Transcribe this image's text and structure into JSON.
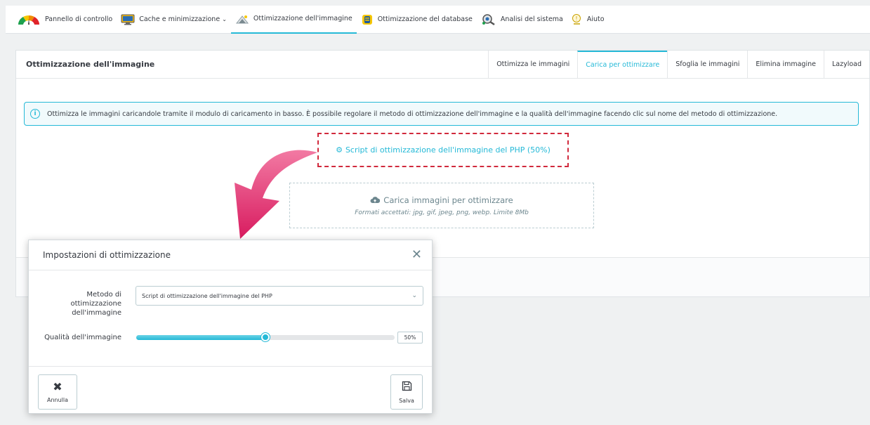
{
  "nav": {
    "items": [
      {
        "label": "Pannello di controllo",
        "icon": "gauge-icon"
      },
      {
        "label": "Cache e minimizzazione",
        "icon": "monitor-icon",
        "has_dropdown": true
      },
      {
        "label": "Ottimizzazione dell'immagine",
        "icon": "image-icon",
        "active": true
      },
      {
        "label": "Ottimizzazione del database",
        "icon": "database-icon"
      },
      {
        "label": "Analisi del sistema",
        "icon": "system-analysis-icon"
      },
      {
        "label": "Aiuto",
        "icon": "help-icon"
      }
    ]
  },
  "panel": {
    "title": "Ottimizzazione dell'immagine",
    "tabs": [
      {
        "label": "Ottimizza le immagini"
      },
      {
        "label": "Carica per ottimizzare",
        "active": true
      },
      {
        "label": "Sfoglia le immagini"
      },
      {
        "label": "Elimina immagine"
      },
      {
        "label": "Lazyload"
      }
    ],
    "info_text": "Ottimizza le immagini caricandole tramite il modulo di caricamento in basso. È possibile regolare il metodo di ottimizzazione dell'immagine e la qualità dell'immagine facendo clic sul nome del metodo di ottimizzazione.",
    "method_link": "Script di ottimizzazione dell'immagine del PHP (50%)",
    "upload_title": "Carica immagini per ottimizzare",
    "upload_sub": "Formati accettati: jpg, gif, jpeg, png, webp. Limite 8Mb"
  },
  "modal": {
    "title": "Impostazioni di ottimizzazione",
    "method_label_lines": [
      "Metodo di",
      "ottimizzazione",
      "dell'immagine"
    ],
    "method_value": "Script di ottimizzazione dell'immagine del PHP",
    "quality_label": "Qualità dell'immagine",
    "quality_value": 50,
    "quality_display": "50%",
    "cancel_label": "Annulla",
    "save_label": "Salva"
  },
  "colors": {
    "accent": "#25b9d7",
    "highlight": "#d12a3d",
    "arrow": "#e8336f"
  }
}
